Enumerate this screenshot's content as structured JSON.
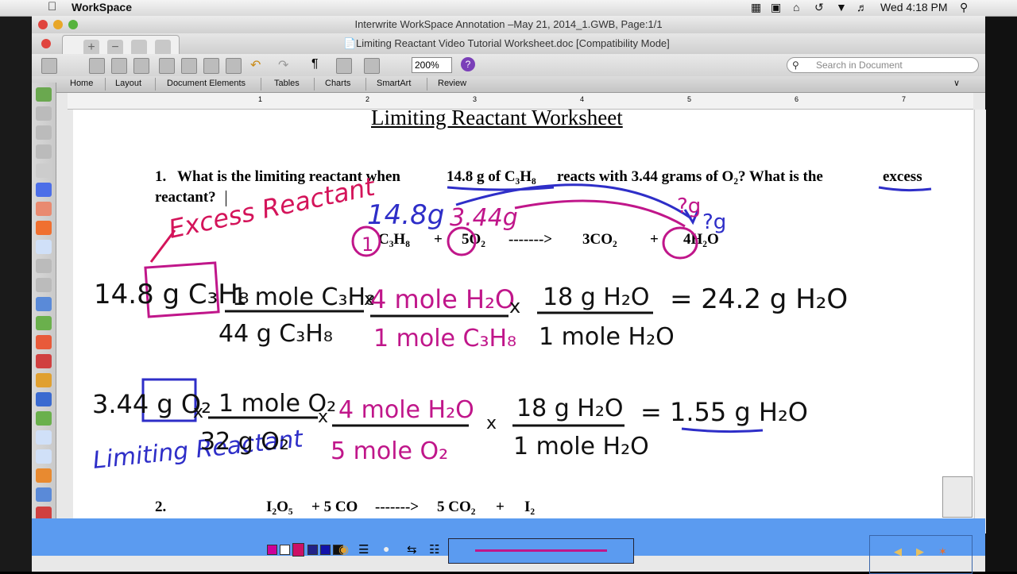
{
  "menubar": {
    "app_name": "WorkSpace",
    "clock": "Wed 4:18 PM"
  },
  "window": {
    "title": "Interwrite WorkSpace Annotation –May 21, 2014_1.GWB, Page:1/1",
    "document_title": "Limiting Reactant Video Tutorial Worksheet.doc [Compatibility Mode]"
  },
  "toolbar": {
    "zoom": "200%",
    "search_placeholder": "Search in Document"
  },
  "ribbon": {
    "tabs": [
      "Home",
      "Layout",
      "Document Elements",
      "Tables",
      "Charts",
      "SmartArt",
      "Review"
    ]
  },
  "ruler": {
    "numbers": [
      "1",
      "2",
      "3",
      "4",
      "5",
      "6",
      "7"
    ]
  },
  "document": {
    "title": "Limiting Reactant Worksheet",
    "q1_number": "1.",
    "q1_text_a": "What is the limiting reactant when",
    "q1_text_b": "14.8 g of C₃H₈",
    "q1_text_c": "reacts with 3.44 grams of O₂?  What is the",
    "q1_text_d": "excess",
    "q1_text_e": "reactant?",
    "equation1": {
      "reactant1": "C₃H₈",
      "plus1": "+",
      "reactant2": "5O₂",
      "arrow": "------->",
      "product1": "3CO₂",
      "plus2": "+",
      "product2": "4H₂O"
    },
    "q2_number": "2.",
    "equation2": {
      "reactant1": "I₂O₅",
      "plus1": "+ 5 CO",
      "arrow": "------->",
      "product1": "5 CO₂",
      "plus2": "+",
      "product2": "I₂"
    }
  },
  "annotations": {
    "excess_label": "Excess Reactant",
    "limiting_label": "Limiting Reactant",
    "given_c3h8": "14.8g",
    "given_o2": "3.44g",
    "unknown_top": "?g",
    "unknown_right": "?g",
    "coef_c3h8": "1",
    "calc1": {
      "start": "14.8 g C₃H₈",
      "f1_num": "1 mole C₃H₈",
      "f1_den": "44 g C₃H₈",
      "f2_num": "4 mole H₂O",
      "f2_den": "1 mole C₃H₈",
      "f3_num": "18 g H₂O",
      "f3_den": "1 mole H₂O",
      "result": "= 24.2 g H₂O"
    },
    "calc2": {
      "start": "3.44 g O₂",
      "f1_num": "1 mole O₂",
      "f1_den": "32 g O₂",
      "f2_num": "4 mole H₂O",
      "f2_den": "5 mole O₂",
      "f3_num": "18 g H₂O",
      "f3_den": "1 mole H₂O",
      "result": "= 1.55 g H₂O"
    },
    "colors": {
      "blue_ink": "#2e2ec8",
      "magenta_ink": "#c0168a",
      "red_ink": "#d4145a",
      "black_ink": "#111111"
    }
  },
  "palette": {
    "swatch_colors": [
      "#cc0099",
      "#ffffff",
      "#cc1166",
      "#222288",
      "#1111aa",
      "#111111"
    ]
  }
}
